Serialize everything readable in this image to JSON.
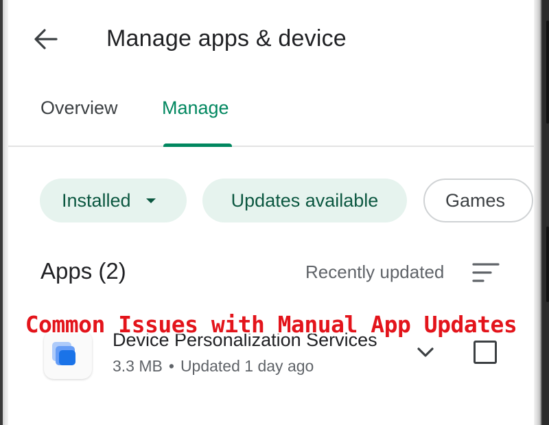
{
  "header": {
    "back_icon": "arrow-back-icon",
    "title": "Manage apps & device"
  },
  "tabs": [
    {
      "label": "Overview",
      "active": false
    },
    {
      "label": "Manage",
      "active": true
    }
  ],
  "filters": [
    {
      "label": "Installed",
      "selected": true,
      "has_dropdown": true
    },
    {
      "label": "Updates available",
      "selected": true
    },
    {
      "label": "Games",
      "selected": false
    }
  ],
  "apps_section": {
    "heading": "Apps (2)",
    "sort_label": "Recently updated",
    "sort_icon": "sort-icon"
  },
  "apps": [
    {
      "name": "Device Personalization Services",
      "size": "3.3 MB",
      "separator": "•",
      "updated": "Updated 1 day ago",
      "icon": "device-personalization-app-icon",
      "expand_icon": "chevron-down-icon",
      "checked": false
    }
  ],
  "overlay": {
    "caption": "Common Issues with Manual App Updates"
  },
  "colors": {
    "accent": "#01875f",
    "chip_bg": "#e6f3ee",
    "chip_text": "#0b5740",
    "caption": "#e3141b"
  }
}
